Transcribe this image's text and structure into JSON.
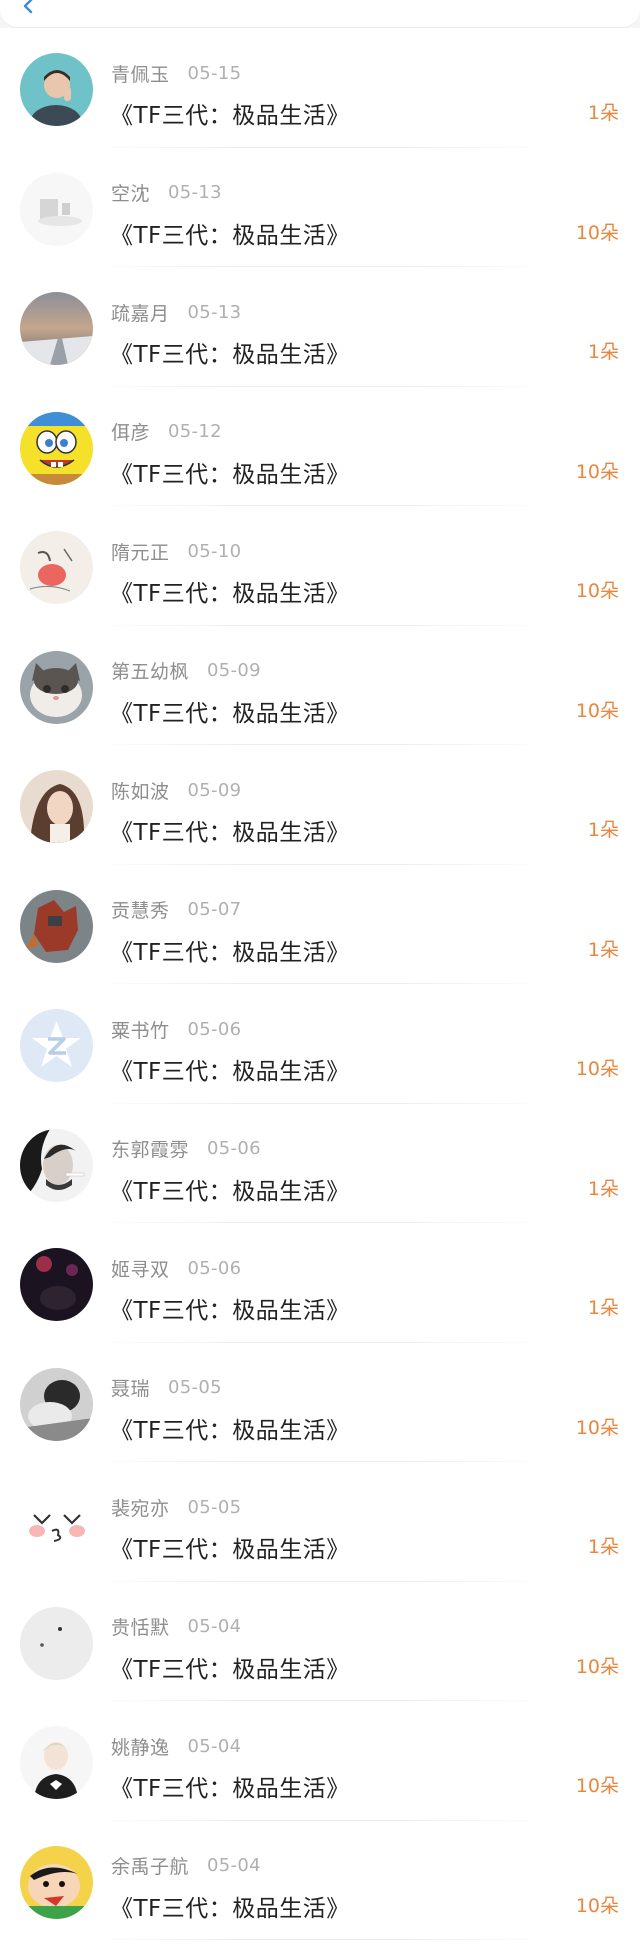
{
  "header": {
    "back_icon": "chevron-left-icon"
  },
  "colors": {
    "amount": "#e8873f",
    "name": "#8e8e8e",
    "date": "#b0b0b0",
    "title": "#222222",
    "back": "#3b8bdb"
  },
  "gifts": [
    {
      "name": "青佩玉",
      "date": "05-15",
      "title": "《TF三代：极品生活》",
      "amount": "1朵",
      "avatar": "boy-photo"
    },
    {
      "name": "空沈",
      "date": "05-13",
      "title": "《TF三代：极品生活》",
      "amount": "10朵",
      "avatar": "pale-sketch"
    },
    {
      "name": "疏嘉月",
      "date": "05-13",
      "title": "《TF三代：极品生活》",
      "amount": "1朵",
      "avatar": "winter-road"
    },
    {
      "name": "佴彦",
      "date": "05-12",
      "title": "《TF三代：极品生活》",
      "amount": "10朵",
      "avatar": "spongebob"
    },
    {
      "name": "隋元正",
      "date": "05-10",
      "title": "《TF三代：极品生活》",
      "amount": "10朵",
      "avatar": "ink-painting"
    },
    {
      "name": "第五幼枫",
      "date": "05-09",
      "title": "《TF三代：极品生活》",
      "amount": "10朵",
      "avatar": "cat"
    },
    {
      "name": "陈如波",
      "date": "05-09",
      "title": "《TF三代：极品生活》",
      "amount": "1朵",
      "avatar": "girl-portrait"
    },
    {
      "name": "贡慧秀",
      "date": "05-07",
      "title": "《TF三代：极品生活》",
      "amount": "1朵",
      "avatar": "robot"
    },
    {
      "name": "粟书竹",
      "date": "05-06",
      "title": "《TF三代：极品生活》",
      "amount": "10朵",
      "avatar": "default-star"
    },
    {
      "name": "东郭霞雰",
      "date": "05-06",
      "title": "《TF三代：极品生活》",
      "amount": "1朵",
      "avatar": "smoking-man"
    },
    {
      "name": "姬寻双",
      "date": "05-06",
      "title": "《TF三代：极品生活》",
      "amount": "1朵",
      "avatar": "dark-night"
    },
    {
      "name": "聂瑞",
      "date": "05-05",
      "title": "《TF三代：极品生活》",
      "amount": "10朵",
      "avatar": "bw-photo"
    },
    {
      "name": "裴宛亦",
      "date": "05-05",
      "title": "《TF三代：极品生活》",
      "amount": "1朵",
      "avatar": "blush-face"
    },
    {
      "name": "贵恬默",
      "date": "05-04",
      "title": "《TF三代：极品生活》",
      "amount": "10朵",
      "avatar": "grey-blank"
    },
    {
      "name": "姚静逸",
      "date": "05-04",
      "title": "《TF三代：极品生活》",
      "amount": "10朵",
      "avatar": "anime-boy"
    },
    {
      "name": "余禹子航",
      "date": "05-04",
      "title": "《TF三代：极品生活》",
      "amount": "10朵",
      "avatar": "shin-chan"
    }
  ]
}
